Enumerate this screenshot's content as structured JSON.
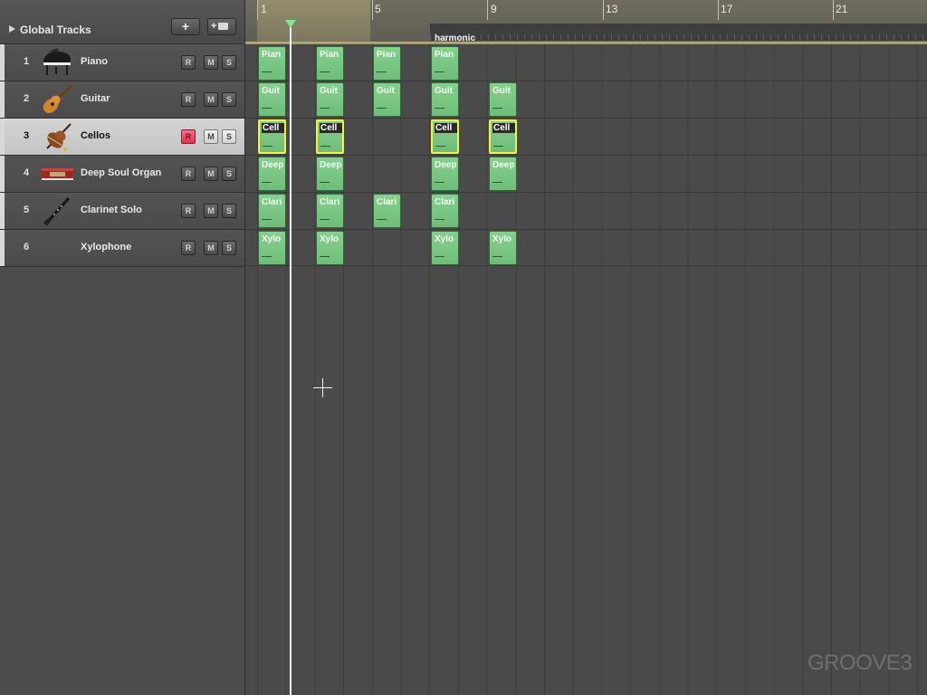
{
  "global_tracks": {
    "label": "Global Tracks",
    "add_track_symbol": "+",
    "add_folder_symbol": "+"
  },
  "tracks": [
    {
      "number": "1",
      "name": "Piano",
      "icon": "piano-icon",
      "record": "R",
      "mute": "M",
      "solo": "S"
    },
    {
      "number": "2",
      "name": "Guitar",
      "icon": "guitar-icon",
      "record": "R",
      "mute": "M",
      "solo": "S"
    },
    {
      "number": "3",
      "name": "Cellos",
      "icon": "cello-icon",
      "record": "R",
      "mute": "M",
      "solo": "S"
    },
    {
      "number": "4",
      "name": "Deep Soul Organ",
      "icon": "organ-icon",
      "record": "R",
      "mute": "M",
      "solo": "S"
    },
    {
      "number": "5",
      "name": "Clarinet Solo",
      "icon": "clarinet-icon",
      "record": "R",
      "mute": "M",
      "solo": "S"
    },
    {
      "number": "6",
      "name": "Xylophone",
      "icon": "xylophone-icon",
      "record": "R",
      "mute": "M",
      "solo": "S"
    }
  ],
  "selected_track": "3",
  "ruler": {
    "bars": [
      "1",
      "5",
      "9",
      "13",
      "17",
      "21"
    ],
    "marker": "harmonic"
  },
  "regions": {
    "piano": [
      "Pian",
      "Pian",
      "Pian",
      "Pian"
    ],
    "guitar": [
      "Guit",
      "Guit",
      "Guit",
      "Guit",
      "Guit"
    ],
    "cellos": [
      "Cell",
      "Cell",
      "Cell",
      "Cell"
    ],
    "organ": [
      "Deep",
      "Deep",
      "Deep",
      "Deep"
    ],
    "clarinet": [
      "Clari",
      "Clari",
      "Clari",
      "Clari"
    ],
    "xylophone": [
      "Xylo",
      "Xylo",
      "Xylo",
      "Xylo"
    ]
  },
  "watermark": "GROOVE3",
  "colors": {
    "region": "#7cc784",
    "selected_region_border": "#f2f04a",
    "record_armed": "#e0405f"
  }
}
